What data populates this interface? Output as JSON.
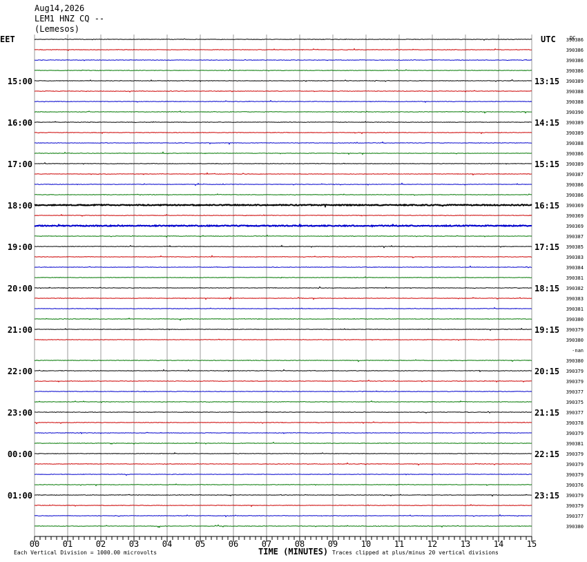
{
  "header": {
    "date": "Aug14,2026",
    "station": "LEM1 HNZ CQ --",
    "location": "(Lemesos)"
  },
  "left_label": "EET",
  "right_label": "UTC",
  "corner_label": "DC",
  "chart_data": {
    "type": "line",
    "title": "LEM1 HNZ CQ --",
    "xlabel": "TIME (MINUTES)",
    "x_ticks": [
      "00",
      "01",
      "02",
      "03",
      "04",
      "05",
      "06",
      "07",
      "08",
      "09",
      "10",
      "11",
      "12",
      "13",
      "14",
      "15"
    ],
    "xlim": [
      0,
      15
    ],
    "left_time_labels": [
      "15:00",
      "16:00",
      "17:00",
      "18:00",
      "19:00",
      "20:00",
      "21:00",
      "22:00",
      "23:00",
      "00:00",
      "01:00"
    ],
    "right_time_labels": [
      "13:15",
      "14:15",
      "15:15",
      "16:15",
      "17:15",
      "18:15",
      "19:15",
      "20:15",
      "21:15",
      "22:15",
      "23:15"
    ],
    "trace_colors": [
      "#000000",
      "#cc0000",
      "#0000cc",
      "#007700"
    ],
    "trace_values": [
      "390386",
      "390386",
      "390386",
      "390386",
      "390389",
      "390388",
      "390388",
      "390390",
      "390389",
      "390389",
      "390388",
      "390386",
      "390389",
      "390387",
      "390386",
      "390386",
      "390369",
      "390369",
      "390369",
      "390387",
      "390385",
      "390383",
      "390384",
      "390381",
      "390382",
      "390383",
      "390381",
      "390380",
      "390379",
      "390380",
      "-nan",
      "390380",
      "390379",
      "390379",
      "390377",
      "390375",
      "390377",
      "390378",
      "390379",
      "390381",
      "390379",
      "390379",
      "390379",
      "390376",
      "390379",
      "390379",
      "390377",
      "390380"
    ],
    "missing_traces": [
      30
    ],
    "bold_traces": [
      16,
      18
    ],
    "footer_left": "Each Vertical Division = 1000.00 microvolts",
    "footer_right": "Traces clipped at plus/minus 20 vertical divisions",
    "grid": true
  }
}
